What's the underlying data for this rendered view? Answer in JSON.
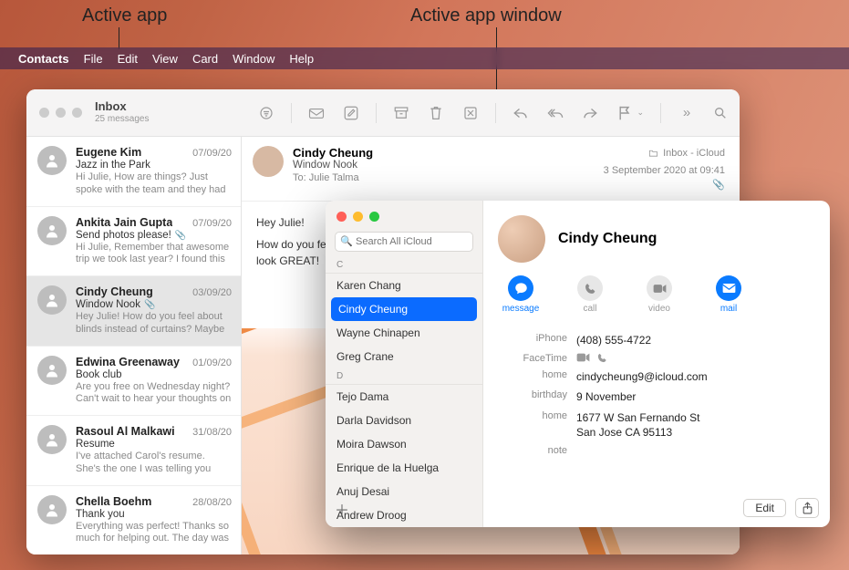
{
  "annotations": {
    "left": "Active app",
    "right": "Active app window"
  },
  "menubar": {
    "app": "Contacts",
    "items": [
      "File",
      "Edit",
      "View",
      "Card",
      "Window",
      "Help"
    ]
  },
  "mail": {
    "title": "Inbox",
    "subtitle": "25 messages",
    "header": {
      "from": "Cindy Cheung",
      "subject": "Window Nook",
      "to_label": "To:",
      "to": "Julie Talma",
      "location": "Inbox - iCloud",
      "datetime": "3 September 2020 at 09:41"
    },
    "body": {
      "line1": "Hey Julie!",
      "line2": "How do you feel about blinds instead of curtains? Maybe a natural wood tone… I think it would look GREAT!"
    },
    "messages": [
      {
        "from": "Eugene Kim",
        "date": "07/09/20",
        "subject": "Jazz in the Park",
        "preview": "Hi Julie, How are things? Just spoke with the team and they had a few co…",
        "selected": false,
        "attachment": false
      },
      {
        "from": "Ankita Jain Gupta",
        "date": "07/09/20",
        "subject": "Send photos please!",
        "preview": "Hi Julie, Remember that awesome trip we took last year? I found this pictur…",
        "selected": false,
        "attachment": true
      },
      {
        "from": "Cindy Cheung",
        "date": "03/09/20",
        "subject": "Window Nook",
        "preview": "Hey Julie! How do you feel about blinds instead of curtains? Maybe a…",
        "selected": true,
        "attachment": true
      },
      {
        "from": "Edwina Greenaway",
        "date": "01/09/20",
        "subject": "Book club",
        "preview": "Are you free on Wednesday night? Can't wait to hear your thoughts on t…",
        "selected": false,
        "attachment": false
      },
      {
        "from": "Rasoul Al Malkawi",
        "date": "31/08/20",
        "subject": "Resume",
        "preview": "I've attached Carol's resume. She's the one I was telling you about. She…",
        "selected": false,
        "attachment": false
      },
      {
        "from": "Chella Boehm",
        "date": "28/08/20",
        "subject": "Thank you",
        "preview": "Everything was perfect! Thanks so much for helping out. The day was a…",
        "selected": false,
        "attachment": false
      }
    ]
  },
  "contacts": {
    "search_placeholder": "Search All iCloud",
    "sections": [
      {
        "letter": "C",
        "items": [
          {
            "name": "Karen Chang",
            "selected": false
          },
          {
            "name": "Cindy Cheung",
            "selected": true
          },
          {
            "name": "Wayne Chinapen",
            "selected": false
          },
          {
            "name": "Greg Crane",
            "selected": false
          }
        ]
      },
      {
        "letter": "D",
        "items": [
          {
            "name": "Tejo Dama",
            "selected": false
          },
          {
            "name": "Darla Davidson",
            "selected": false
          },
          {
            "name": "Moira Dawson",
            "selected": false
          },
          {
            "name": "Enrique de la Huelga",
            "selected": false
          },
          {
            "name": "Anuj Desai",
            "selected": false
          },
          {
            "name": "Andrew Droog",
            "selected": false
          }
        ]
      }
    ],
    "card": {
      "name": "Cindy Cheung",
      "actions": {
        "message": "message",
        "call": "call",
        "video": "video",
        "mail": "mail"
      },
      "fields": {
        "iphone_label": "iPhone",
        "iphone": "(408) 555-4722",
        "facetime_label": "FaceTime",
        "home_email_label": "home",
        "home_email": "cindycheung9@icloud.com",
        "birthday_label": "birthday",
        "birthday": "9 November",
        "home_addr_label": "home",
        "home_addr_line1": "1677 W San Fernando St",
        "home_addr_line2": "San Jose CA 95113",
        "note_label": "note"
      },
      "edit": "Edit"
    }
  }
}
